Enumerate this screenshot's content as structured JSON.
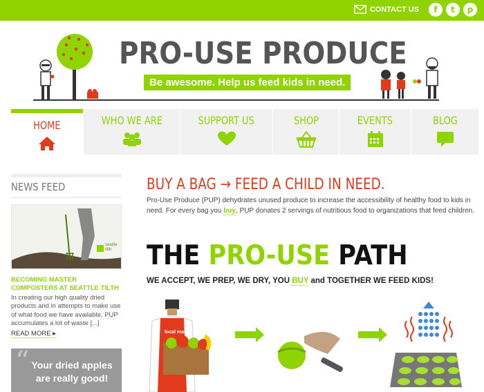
{
  "topbar": {
    "contact_label": "CONTACT US",
    "social": [
      {
        "icon": "facebook-icon",
        "glyph": "f"
      },
      {
        "icon": "twitter-icon",
        "glyph": "t"
      },
      {
        "icon": "pinterest-icon",
        "glyph": "p"
      }
    ]
  },
  "header": {
    "brand": "PRO-USE PRODUCE",
    "tagline": "Be awesome. Help us feed kids in need."
  },
  "nav": [
    {
      "label": "HOME",
      "icon": "home-icon",
      "active": true
    },
    {
      "label": "WHO WE ARE",
      "icon": "people-icon",
      "active": false
    },
    {
      "label": "SUPPORT US",
      "icon": "heart-icon",
      "active": false
    },
    {
      "label": "SHOP",
      "icon": "basket-icon",
      "active": false
    },
    {
      "label": "EVENTS",
      "icon": "calendar-icon",
      "active": false
    },
    {
      "label": "BLOG",
      "icon": "speech-bubble-icon",
      "active": false
    }
  ],
  "sidebar": {
    "title": "NEWS FEED",
    "image_badge": "seattle tilth",
    "headline": "BECOMING MASTER COMPOSTERS AT SEATTLE TILTH",
    "body": "In creating our high quality dried products and in attempts to make use of what food we have available, PUP accumulates a lot of waste [...]",
    "read_more": "READ MORE ▸",
    "quote": "Your dried apples are really good!"
  },
  "main": {
    "buy_heading": "BUY A BAG → FEED A CHILD IN NEED.",
    "intro_before": "Pro-Use Produce (PUP) dehydrates unused produce to increase the accessibility of healthy food to kids in need. For every bag you ",
    "intro_link": "buy",
    "intro_after": ", PUP donates 2 servings of nutritious food to organizations that feed children.",
    "path_the": "THE ",
    "path_green": "PRO-USE",
    "path_end": " PATH",
    "sub_before": "WE ACCEPT, WE PREP, WE DRY, YOU ",
    "sub_link": "BUY",
    "sub_after": " and TOGETHER WE FEED KIDS!",
    "apron_text": "local market"
  },
  "colors": {
    "accent": "#8fd400",
    "active": "#e23a1c",
    "text": "#444444"
  }
}
